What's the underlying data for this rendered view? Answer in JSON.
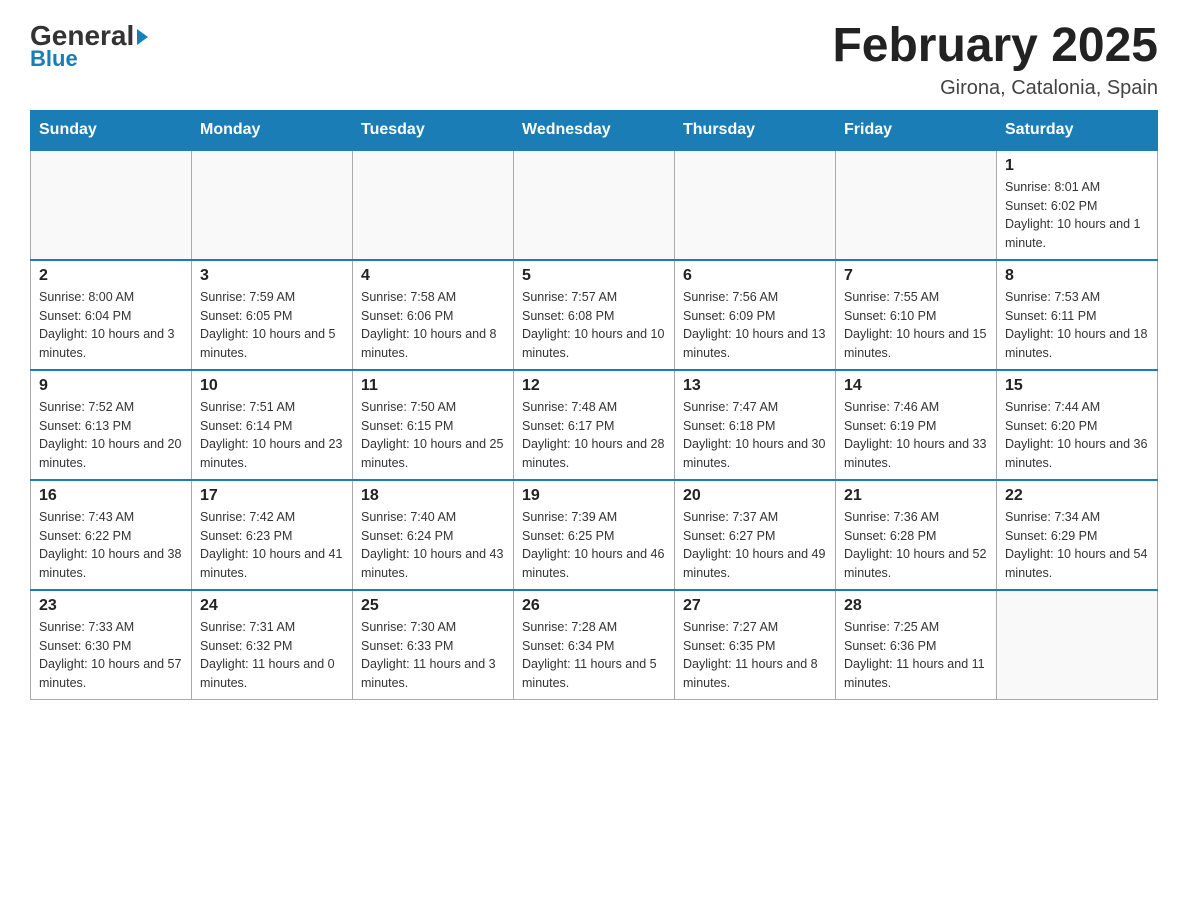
{
  "logo": {
    "general": "General",
    "blue_text": "Blue",
    "triangle": "▶"
  },
  "header": {
    "month_title": "February 2025",
    "location": "Girona, Catalonia, Spain"
  },
  "weekdays": [
    "Sunday",
    "Monday",
    "Tuesday",
    "Wednesday",
    "Thursday",
    "Friday",
    "Saturday"
  ],
  "weeks": [
    [
      {
        "day": "",
        "info": ""
      },
      {
        "day": "",
        "info": ""
      },
      {
        "day": "",
        "info": ""
      },
      {
        "day": "",
        "info": ""
      },
      {
        "day": "",
        "info": ""
      },
      {
        "day": "",
        "info": ""
      },
      {
        "day": "1",
        "info": "Sunrise: 8:01 AM\nSunset: 6:02 PM\nDaylight: 10 hours and 1 minute."
      }
    ],
    [
      {
        "day": "2",
        "info": "Sunrise: 8:00 AM\nSunset: 6:04 PM\nDaylight: 10 hours and 3 minutes."
      },
      {
        "day": "3",
        "info": "Sunrise: 7:59 AM\nSunset: 6:05 PM\nDaylight: 10 hours and 5 minutes."
      },
      {
        "day": "4",
        "info": "Sunrise: 7:58 AM\nSunset: 6:06 PM\nDaylight: 10 hours and 8 minutes."
      },
      {
        "day": "5",
        "info": "Sunrise: 7:57 AM\nSunset: 6:08 PM\nDaylight: 10 hours and 10 minutes."
      },
      {
        "day": "6",
        "info": "Sunrise: 7:56 AM\nSunset: 6:09 PM\nDaylight: 10 hours and 13 minutes."
      },
      {
        "day": "7",
        "info": "Sunrise: 7:55 AM\nSunset: 6:10 PM\nDaylight: 10 hours and 15 minutes."
      },
      {
        "day": "8",
        "info": "Sunrise: 7:53 AM\nSunset: 6:11 PM\nDaylight: 10 hours and 18 minutes."
      }
    ],
    [
      {
        "day": "9",
        "info": "Sunrise: 7:52 AM\nSunset: 6:13 PM\nDaylight: 10 hours and 20 minutes."
      },
      {
        "day": "10",
        "info": "Sunrise: 7:51 AM\nSunset: 6:14 PM\nDaylight: 10 hours and 23 minutes."
      },
      {
        "day": "11",
        "info": "Sunrise: 7:50 AM\nSunset: 6:15 PM\nDaylight: 10 hours and 25 minutes."
      },
      {
        "day": "12",
        "info": "Sunrise: 7:48 AM\nSunset: 6:17 PM\nDaylight: 10 hours and 28 minutes."
      },
      {
        "day": "13",
        "info": "Sunrise: 7:47 AM\nSunset: 6:18 PM\nDaylight: 10 hours and 30 minutes."
      },
      {
        "day": "14",
        "info": "Sunrise: 7:46 AM\nSunset: 6:19 PM\nDaylight: 10 hours and 33 minutes."
      },
      {
        "day": "15",
        "info": "Sunrise: 7:44 AM\nSunset: 6:20 PM\nDaylight: 10 hours and 36 minutes."
      }
    ],
    [
      {
        "day": "16",
        "info": "Sunrise: 7:43 AM\nSunset: 6:22 PM\nDaylight: 10 hours and 38 minutes."
      },
      {
        "day": "17",
        "info": "Sunrise: 7:42 AM\nSunset: 6:23 PM\nDaylight: 10 hours and 41 minutes."
      },
      {
        "day": "18",
        "info": "Sunrise: 7:40 AM\nSunset: 6:24 PM\nDaylight: 10 hours and 43 minutes."
      },
      {
        "day": "19",
        "info": "Sunrise: 7:39 AM\nSunset: 6:25 PM\nDaylight: 10 hours and 46 minutes."
      },
      {
        "day": "20",
        "info": "Sunrise: 7:37 AM\nSunset: 6:27 PM\nDaylight: 10 hours and 49 minutes."
      },
      {
        "day": "21",
        "info": "Sunrise: 7:36 AM\nSunset: 6:28 PM\nDaylight: 10 hours and 52 minutes."
      },
      {
        "day": "22",
        "info": "Sunrise: 7:34 AM\nSunset: 6:29 PM\nDaylight: 10 hours and 54 minutes."
      }
    ],
    [
      {
        "day": "23",
        "info": "Sunrise: 7:33 AM\nSunset: 6:30 PM\nDaylight: 10 hours and 57 minutes."
      },
      {
        "day": "24",
        "info": "Sunrise: 7:31 AM\nSunset: 6:32 PM\nDaylight: 11 hours and 0 minutes."
      },
      {
        "day": "25",
        "info": "Sunrise: 7:30 AM\nSunset: 6:33 PM\nDaylight: 11 hours and 3 minutes."
      },
      {
        "day": "26",
        "info": "Sunrise: 7:28 AM\nSunset: 6:34 PM\nDaylight: 11 hours and 5 minutes."
      },
      {
        "day": "27",
        "info": "Sunrise: 7:27 AM\nSunset: 6:35 PM\nDaylight: 11 hours and 8 minutes."
      },
      {
        "day": "28",
        "info": "Sunrise: 7:25 AM\nSunset: 6:36 PM\nDaylight: 11 hours and 11 minutes."
      },
      {
        "day": "",
        "info": ""
      }
    ]
  ]
}
